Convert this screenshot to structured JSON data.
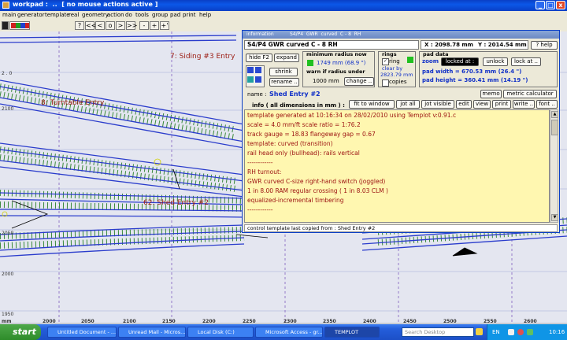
{
  "window": {
    "title": "workpad :  ..  [ no mouse actions active ]"
  },
  "menu": [
    "main",
    "generator",
    "template",
    "real",
    "geometry",
    "action",
    "do",
    "tools",
    "group",
    "pad",
    "print",
    "help"
  ],
  "toolbar": {
    "buttons": [
      "?",
      "<<",
      "<",
      "o",
      ">",
      ">>",
      "-",
      "+",
      "+'"
    ]
  },
  "canvas": {
    "labels": {
      "siding": "7: Siding #3 Entry",
      "turntable": "8: Turntable Entry",
      "shed": "62: Shed Entry #2"
    },
    "y_axis": [
      "2100",
      "2050",
      "2000",
      "1950"
    ],
    "x_axis": [
      "mm",
      "2000",
      "2050",
      "2100",
      "2150",
      "2200",
      "2250",
      "2300",
      "2350",
      "2400",
      "2450",
      "2500",
      "2550",
      "2600"
    ]
  },
  "info": {
    "title_left": "information",
    "title_right": "S4/P4  GWR  curved  C - 8  RH",
    "template_name": "S4/P4  GWR  curved  C - 8  RH",
    "x_readout": "X : 2098.78 mm",
    "y_readout": "Y : 2014.54 mm",
    "help": "? help",
    "hide": "hide  F2",
    "expand": "expand",
    "shrink": "shrink",
    "rename": "rename ..",
    "min_radius_label": "minimum  radius  now",
    "min_radius_value": "1749 mm  (68.9 \")",
    "warn_label": "warn  if  radius  under",
    "warn_value": "1000 mm",
    "change": "change ..",
    "rings_label": "rings",
    "ring": "ring",
    "clear_by": "clear by",
    "clear_value": "2823.79 mm",
    "copies": "copies",
    "pad_data": "pad  data",
    "zoom": "zoom :",
    "locked_at": "locked  at :",
    "unlock": "unlock",
    "lock_at": "lock  at ..",
    "pad_width": "pad  width   =  670.53 mm  (26.4 \")",
    "pad_height": "pad  height  =  360.41 mm  (14.19 \")",
    "name_label": "name :",
    "name_value": "Shed Entry #2",
    "memo": "memo",
    "metric": "metric calculator",
    "info_caption": "info  ( all  dimensions  in  mm ) :",
    "buttons": [
      "fit to window",
      "jot all",
      "jot visible",
      "edit",
      "view",
      "print",
      "write ..",
      "font .."
    ],
    "text_lines": [
      "template generated at 10:16:34 on 28/02/2010 using Templot v:0.91.c",
      "scale = 4.0 mm/ft     scale ratio = 1:76.2",
      "track gauge = 18.83    flangeway gap = 0.67",
      "template: curved (transition)",
      "rail head only (bullhead): rails vertical",
      "------------",
      "RH turnout:",
      "GWR  curved   C-size right-hand switch (joggled)",
      "1 in 8.00 RAM regular crossing  ( 1 in 8.03 CLM )",
      "equalized-incremental timbering",
      "------------"
    ],
    "status": "control  template  last  copied  from :  Shed Entry #2"
  },
  "taskbar": {
    "start": "start",
    "tasks": [
      "Untitled Document - ...",
      "Unread Mail - Micros...",
      "Local Disk (C:)",
      "Microsoft Access - gr...",
      "TEMPLOT"
    ],
    "search_placeholder": "Search Desktop",
    "lang": "EN",
    "clock": "10:16"
  }
}
